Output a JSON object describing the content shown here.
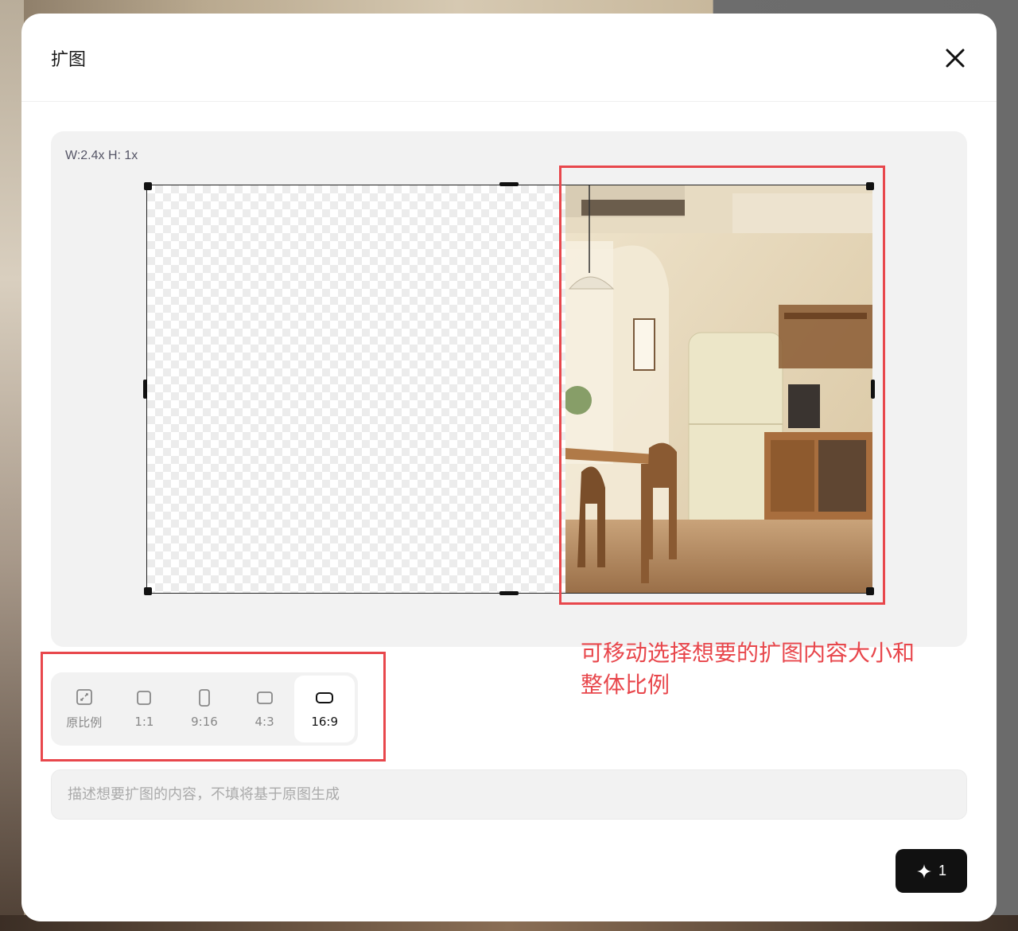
{
  "modal": {
    "title": "扩图",
    "close_icon": "close-icon"
  },
  "canvas": {
    "scale_readout": "W:2.4x H: 1x"
  },
  "annotation": {
    "text": "可移动选择想要的扩图内容大小和整体比例",
    "color": "#e8474c"
  },
  "ratios": {
    "selected": "16:9",
    "items": [
      {
        "label": "原比例",
        "icon": "original-ratio-icon"
      },
      {
        "label": "1:1",
        "icon": "square-icon"
      },
      {
        "label": "9:16",
        "icon": "portrait-icon"
      },
      {
        "label": "4:3",
        "icon": "landscape-icon"
      },
      {
        "label": "16:9",
        "icon": "wide-landscape-icon"
      }
    ]
  },
  "prompt": {
    "placeholder": "描述想要扩图的内容，不填将基于原图生成",
    "value": ""
  },
  "generate": {
    "icon": "sparkle-icon",
    "count": "1"
  }
}
